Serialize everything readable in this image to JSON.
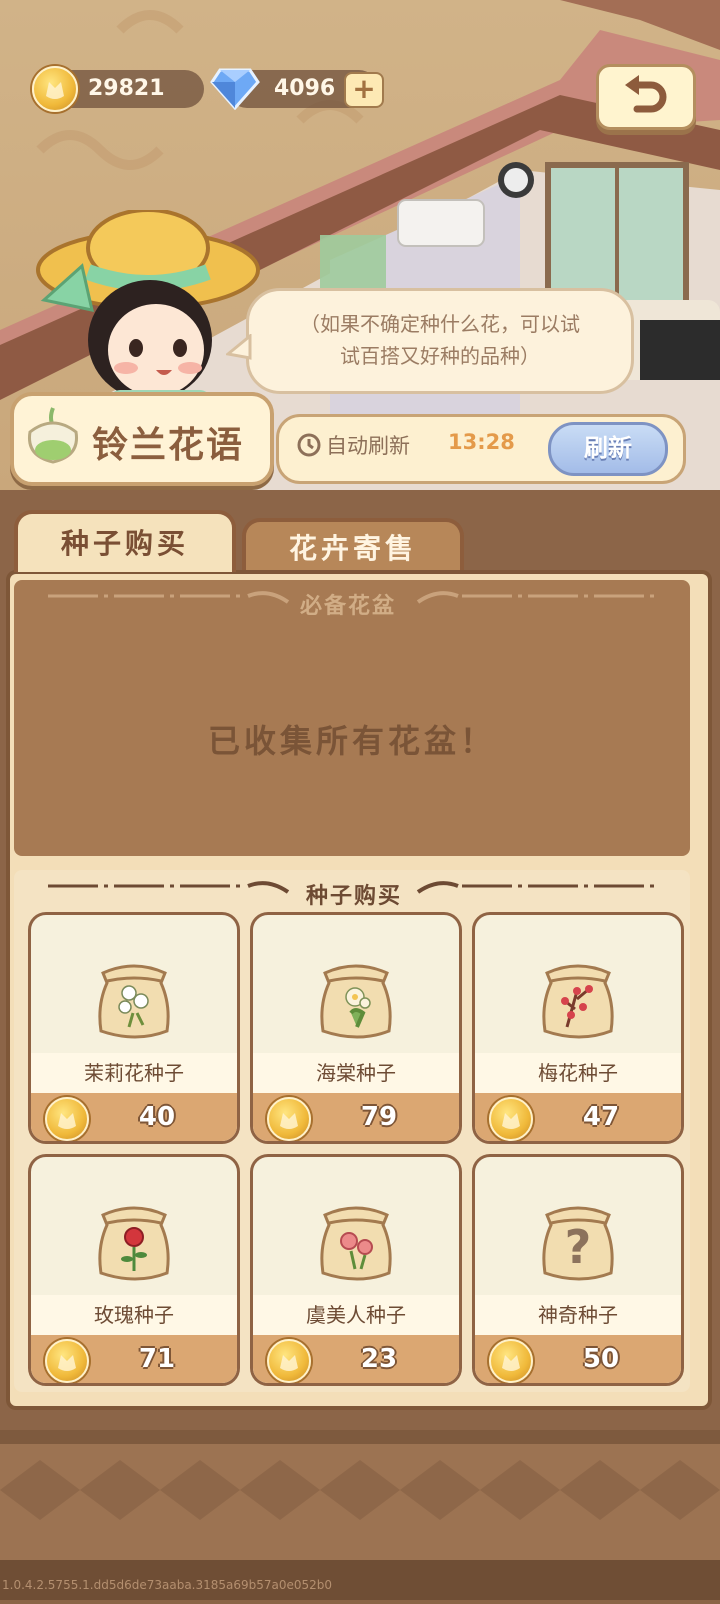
{
  "currency": {
    "coins": "29821",
    "gems": "4096",
    "add_label": "+"
  },
  "npc": {
    "bubble_lines": [
      "（如果不确定种什么花，可以试",
      "试百搭又好种的品种）"
    ],
    "name": "铃兰花语"
  },
  "refresh": {
    "label": "自动刷新",
    "time": "13:28",
    "button": "刷新"
  },
  "tabs": [
    {
      "label": "种子购买",
      "active": true
    },
    {
      "label": "花卉寄售",
      "active": false
    }
  ],
  "pots_section": {
    "title": "必备花盆",
    "message": "已收集所有花盆！"
  },
  "seeds_section": {
    "title": "种子购买",
    "items": [
      {
        "name": "茉莉花种子",
        "price": "40",
        "icon": "jasmine-flower-icon"
      },
      {
        "name": "海棠种子",
        "price": "79",
        "icon": "begonia-flower-icon"
      },
      {
        "name": "梅花种子",
        "price": "47",
        "icon": "plum-blossom-icon"
      },
      {
        "name": "玫瑰种子",
        "price": "71",
        "icon": "rose-icon"
      },
      {
        "name": "虞美人种子",
        "price": "23",
        "icon": "poppy-icon"
      },
      {
        "name": "神奇种子",
        "price": "50",
        "icon": "question-mark-icon"
      }
    ]
  },
  "version": "1.0.4.2.5755.1.dd5d6de73aaba.3185a69b57a0e052b0",
  "colors": {
    "accent": "#dba772",
    "frame": "#8d5d3c",
    "refresh_button": "#a3bce8"
  }
}
